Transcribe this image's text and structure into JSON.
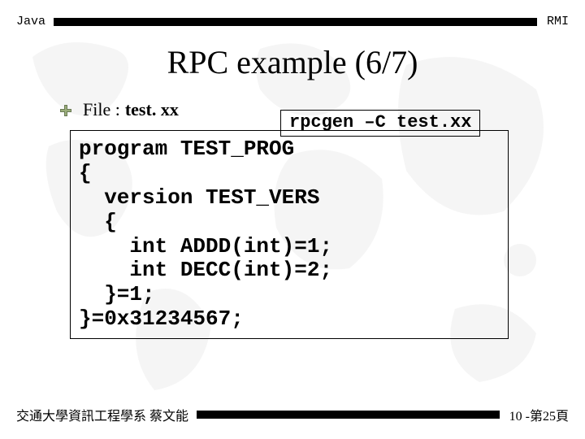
{
  "header": {
    "left": "Java",
    "right": "RMI"
  },
  "title": "RPC example  (6/7)",
  "file_row": {
    "label": "File :",
    "name": "test. xx"
  },
  "command_box": "rpcgen –C test.xx",
  "code": "program TEST_PROG\n{\n  version TEST_VERS\n  {\n    int ADDD(int)=1;\n    int DECC(int)=2;\n  }=1;\n}=0x31234567;",
  "footer": {
    "left": "交通大學資訊工程學系 蔡文能",
    "right": "10 -第25頁"
  }
}
